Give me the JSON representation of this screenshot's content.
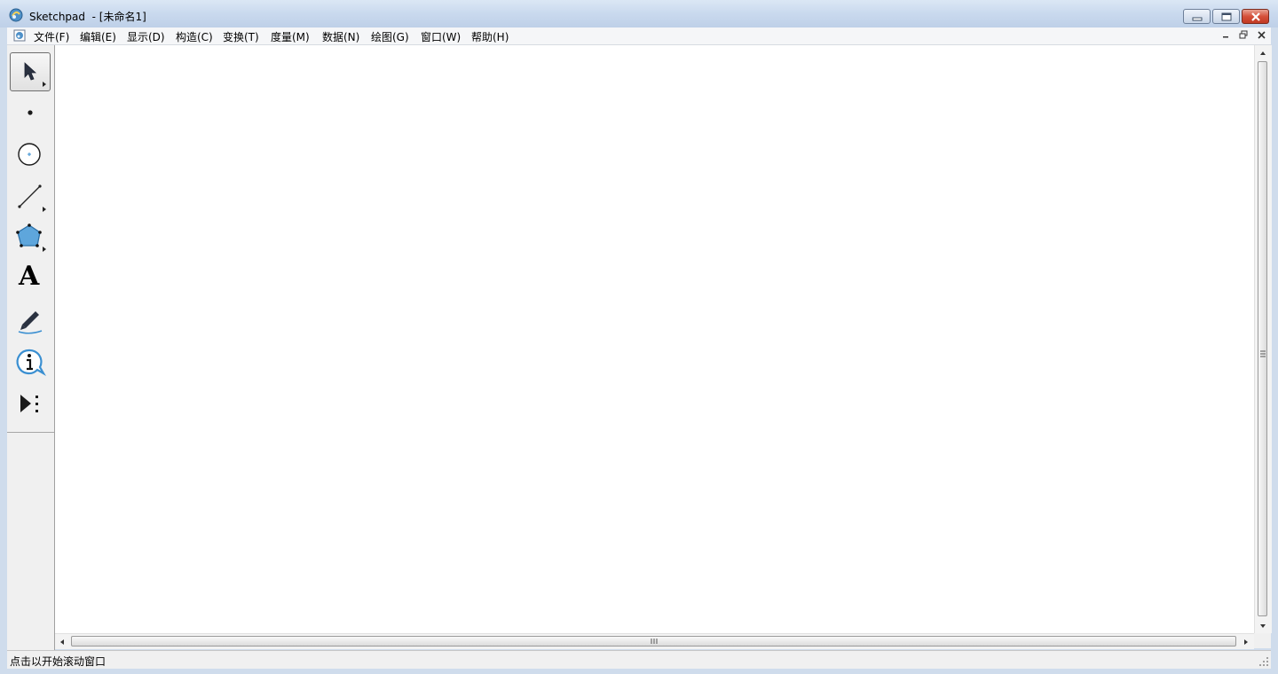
{
  "window": {
    "title": "Sketchpad  - [未命名1]",
    "accent": "#c9d9ee",
    "close_color": "#c23a24"
  },
  "menu": {
    "items": [
      {
        "label": "文件(F)",
        "icon": "file-menu"
      },
      {
        "label": "编辑(E)",
        "icon": "edit-menu"
      },
      {
        "label": "显示(D)",
        "icon": "display-menu"
      },
      {
        "label": "构造(C)",
        "icon": "construct-menu"
      },
      {
        "label": "变换(T)",
        "icon": "transform-menu"
      },
      {
        "label": "度量(M)",
        "icon": "measure-menu"
      },
      {
        "label": "数据(N)",
        "icon": "data-menu"
      },
      {
        "label": "绘图(G)",
        "icon": "graph-menu"
      },
      {
        "label": "窗口(W)",
        "icon": "window-menu"
      },
      {
        "label": "帮助(H)",
        "icon": "help-menu"
      }
    ]
  },
  "toolbox": {
    "tools": [
      {
        "name": "selection-arrow-tool",
        "icon": "arrow-icon",
        "selected": true
      },
      {
        "name": "point-tool",
        "icon": "point-icon"
      },
      {
        "name": "compass-tool",
        "icon": "circle-icon"
      },
      {
        "name": "straightedge-tool",
        "icon": "segment-icon"
      },
      {
        "name": "polygon-tool",
        "icon": "pentagon-icon"
      },
      {
        "name": "text-tool",
        "icon": "text-icon",
        "glyph": "A"
      },
      {
        "name": "marker-tool",
        "icon": "marker-icon"
      },
      {
        "name": "information-tool",
        "icon": "info-icon"
      },
      {
        "name": "custom-tool",
        "icon": "custom-tools-icon"
      }
    ]
  },
  "status": {
    "text": "点击以开始滚动窗口"
  }
}
